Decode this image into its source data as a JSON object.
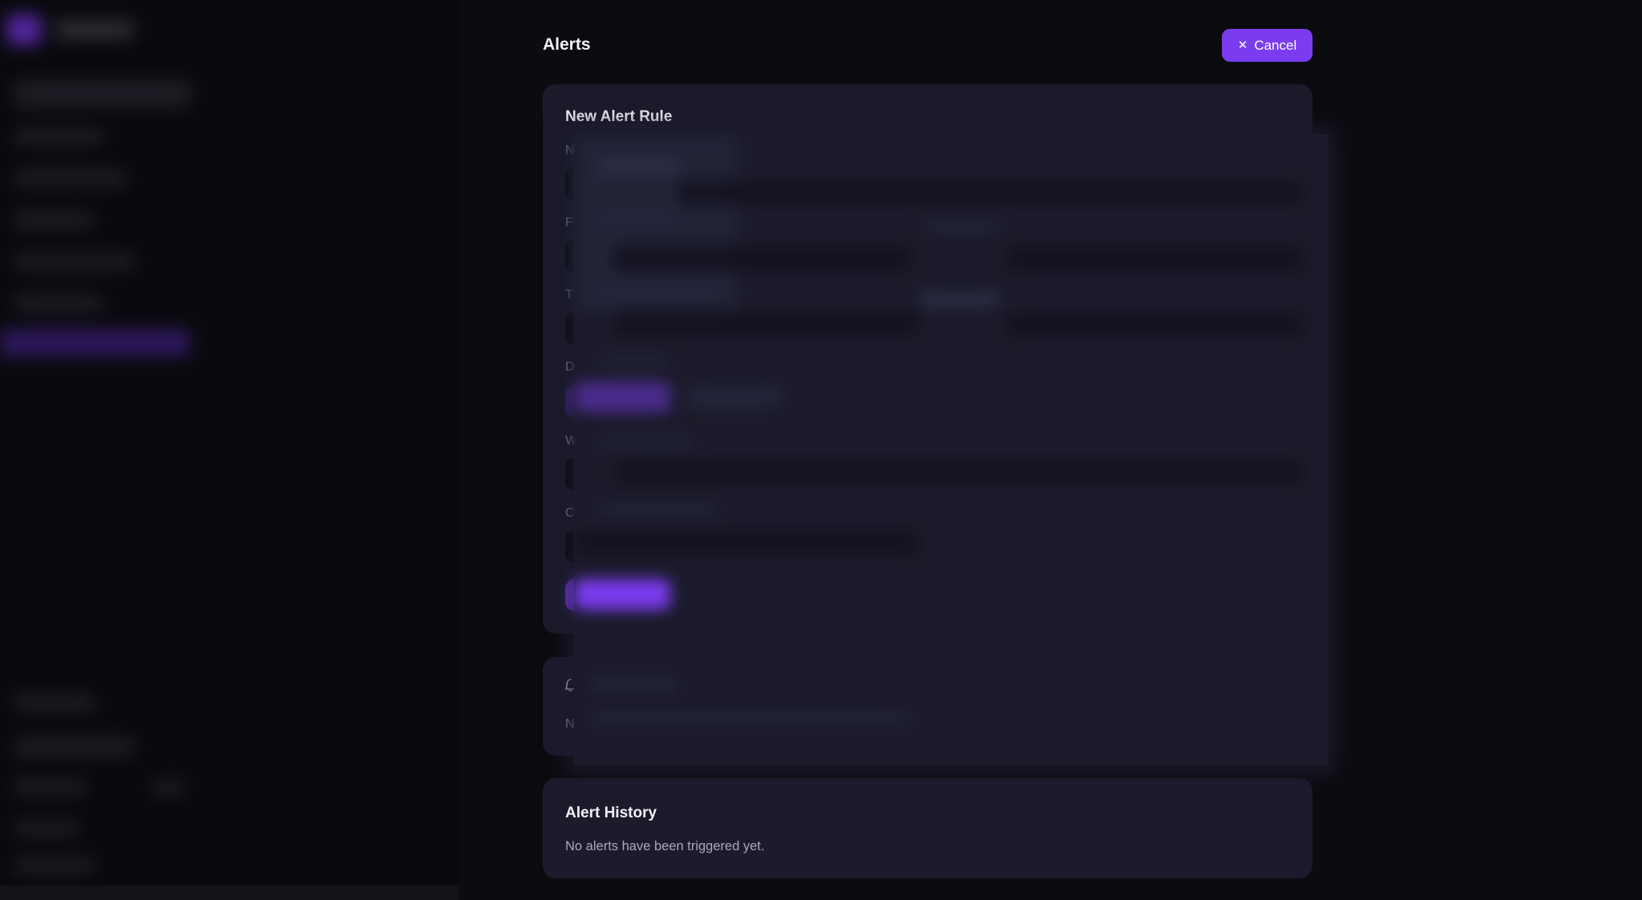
{
  "header": {
    "title": "Alerts",
    "cancel_label": "Cancel"
  },
  "form": {
    "title": "New Alert Rule",
    "label_initials": [
      "N",
      "F",
      "T",
      "D",
      "W",
      "C"
    ]
  },
  "rules": {
    "empty_initial": "N"
  },
  "history": {
    "title": "Alert History",
    "empty_text": "No alerts have been triggered yet."
  },
  "colors": {
    "accent": "#7b3cf0",
    "card": "#1b1b2c",
    "background": "#0b0b10"
  },
  "icons": {
    "cancel": "close-icon",
    "rules": "bell-icon"
  }
}
